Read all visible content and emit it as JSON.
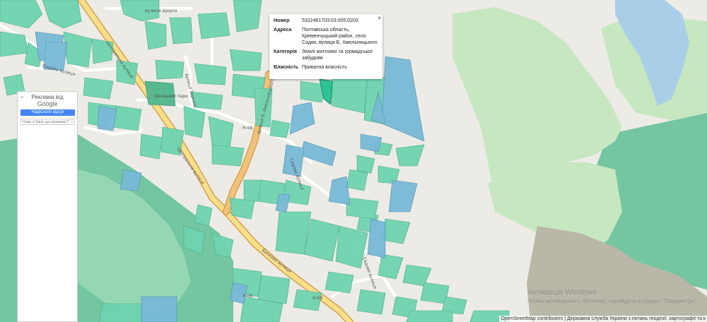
{
  "map": {
    "street_labels": {
      "shchors": "вулиця Щорса",
      "sadova_top": "Садова вулиця",
      "zarichna": "вулиця Зарічна",
      "tsentralna1": "Центральна вулиця",
      "tsentralna2": "Центральна вулиця",
      "khmelnytskoho": "вулиця Б. Хмельницького",
      "sadova": "Садова вулиця",
      "bank": "Банкова вулиця",
      "sadova_low": "Садова вулиця",
      "park": "Шкільний парк",
      "h08a": "Н-08",
      "h08b": "Н-08",
      "h08c": "Н-08"
    }
  },
  "popup": {
    "rows": [
      {
        "key": "Номер",
        "value": "5322481703:03:005:0203"
      },
      {
        "key": "Адреса",
        "value": "Полтавська область, Кременчуцький район, село Садки, вулиця Б. Хмельницького"
      },
      {
        "key": "Категорія",
        "value": "Землі житлової та громадської забудови"
      },
      {
        "key": "Власність",
        "value": "Приватна власність"
      }
    ],
    "close": "×"
  },
  "ad": {
    "back": "←",
    "title": "Реклама від",
    "brand": "Google",
    "feedback_button": "Надіслати відгук",
    "why_button": "Чому я бачу цю рекламу? ⓘ"
  },
  "watermark": {
    "line1": "Активація Windows",
    "line2": "Чтобы активировать Windows, перейдите в раздел \"Параметры\"."
  },
  "attribution": {
    "osm": "OpenStreetMap contributors",
    "rest": " | Державна служба України з питань геодезії, картографії та к"
  },
  "colors": {
    "background": "#ecebe6",
    "parcel_green": "#6fd3b0",
    "parcel_blue": "#79b9d6",
    "forest": "#5fbf93",
    "meadow": "#c6e7c0",
    "main_road": "#f1c37a",
    "water": "#a9cfe8",
    "selected_parcel": "#2fc495"
  }
}
